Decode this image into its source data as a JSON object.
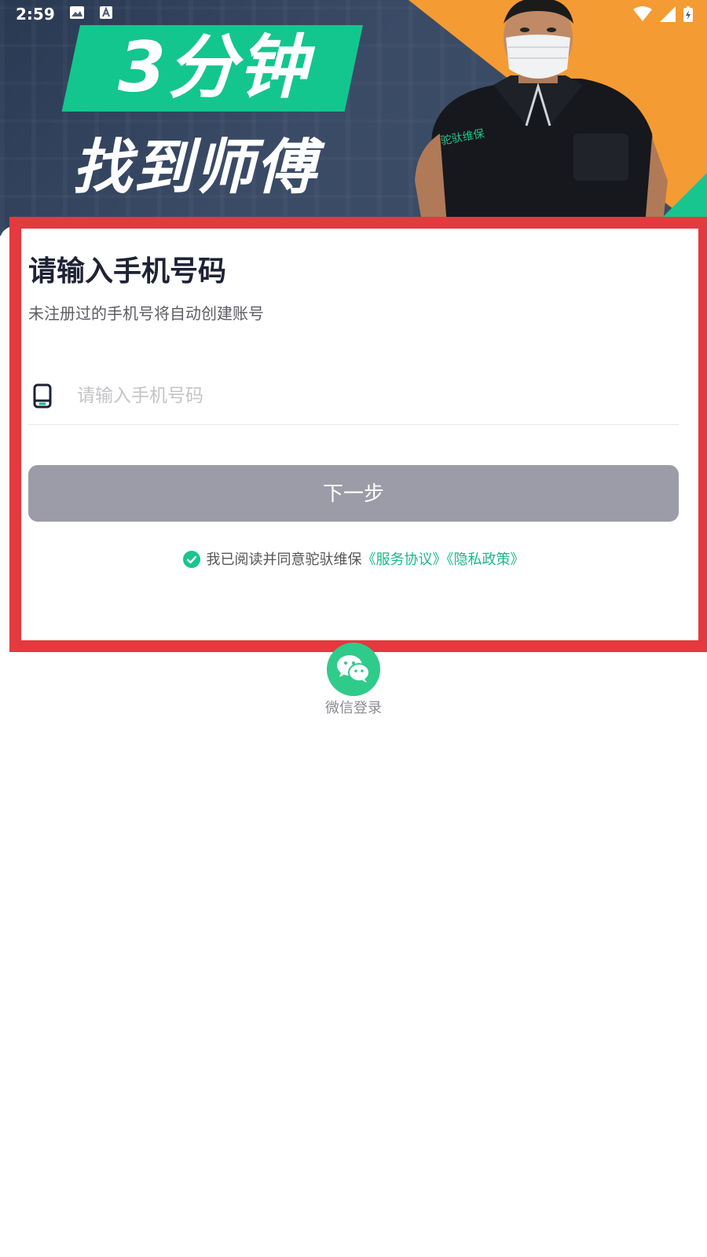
{
  "status_bar": {
    "time": "2:59"
  },
  "banner": {
    "slogan_line1": "3分钟",
    "slogan_line2": "找到师傅",
    "vest_text": "驼驮维保"
  },
  "login": {
    "title": "请输入手机号码",
    "subtitle": "未注册过的手机号将自动创建账号",
    "phone_input": {
      "value": "",
      "placeholder": "请输入手机号码"
    },
    "next_button_label": "下一步",
    "agreement": {
      "prefix": "我已阅读并同意驼驮维保",
      "service_link": "《服务协议》",
      "privacy_link": "《隐私政策》"
    },
    "wechat_login_label": "微信登录"
  },
  "colors": {
    "accent_green": "#19b98a",
    "button_disabled": "#9c9ca8",
    "highlight_red": "#e3393f",
    "banner_orange": "#f59b33"
  }
}
